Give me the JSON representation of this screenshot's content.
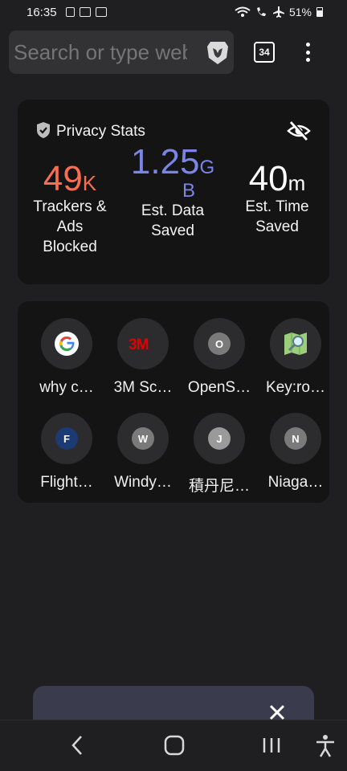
{
  "status_bar": {
    "time": "16:35",
    "battery": "51%",
    "left_icons": [
      "notification-phone-icon",
      "notification-box-icon",
      "notification-image-icon"
    ],
    "right_icons": [
      "wifi-calling-icon",
      "volte-call-icon",
      "airplane-icon",
      "battery-icon"
    ]
  },
  "url_bar": {
    "placeholder": "Search or type web address",
    "shields_icon": "brave-lion-icon"
  },
  "toolbar": {
    "tab_count": "34",
    "menu_icon": "more-vert-icon"
  },
  "privacy_stats": {
    "title": "Privacy Stats",
    "trackers": {
      "value": "49",
      "unit": "K",
      "label_lines": [
        "Trackers &",
        "Ads",
        "Blocked"
      ]
    },
    "data_saved": {
      "value": "1.25",
      "unit": "G",
      "unit2": "B",
      "label_lines": [
        "Est. Data",
        "Saved"
      ]
    },
    "time_saved": {
      "value": "40",
      "unit": "m",
      "label_lines": [
        "Est. Time",
        "Saved"
      ]
    },
    "accent_colors": {
      "trackers": "#fb6d4d",
      "data": "#7b85e6",
      "time": "#ffffff"
    }
  },
  "top_sites": [
    {
      "label": "why c…",
      "icon": "google-icon"
    },
    {
      "label": "3M Sc…",
      "icon": "3m-logo-icon"
    },
    {
      "label": "OpenS…",
      "letter": "O"
    },
    {
      "label": "Key:ro…",
      "icon": "map-search-icon"
    },
    {
      "label": "Flight…",
      "letter": "F"
    },
    {
      "label": "Windy…",
      "letter": "W"
    },
    {
      "label": "積丹尼…",
      "letter": "J"
    },
    {
      "label": "Niaga…",
      "letter": "N"
    }
  ],
  "bottom_sheet": {
    "background": "#3a3c4e",
    "close_icon": "close-icon"
  },
  "nav_bar": {
    "icons": [
      "back-icon",
      "home-icon",
      "recents-icon",
      "accessibility-icon"
    ]
  }
}
